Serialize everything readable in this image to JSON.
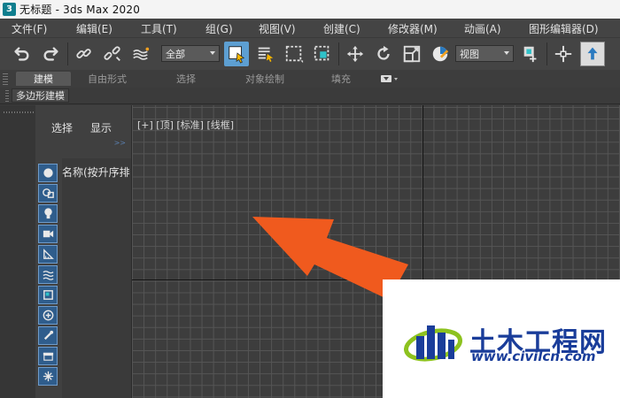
{
  "window": {
    "app_icon_letter": "3",
    "title": "无标题 - 3ds Max 2020"
  },
  "menu": {
    "items": [
      "文件(F)",
      "编辑(E)",
      "工具(T)",
      "组(G)",
      "视图(V)",
      "创建(C)",
      "修改器(M)",
      "动画(A)",
      "图形编辑器(D)"
    ]
  },
  "toolbar": {
    "selection_filter": "全部",
    "reference_coord": "视图",
    "icons": [
      "undo-icon",
      "redo-icon",
      "link-icon",
      "unlink-icon",
      "bind-space-warp-icon",
      "select-object-icon",
      "select-by-name-icon",
      "rect-selection-region-icon",
      "window-crossing-icon",
      "move-icon",
      "rotate-icon",
      "scale-icon",
      "selection-pivot-icon",
      "snap-icon",
      "select-and-place-icon"
    ],
    "active_color": "#5d9fd2"
  },
  "ribbon": {
    "tabs": [
      "建模",
      "自由形式",
      "选择",
      "对象绘制",
      "填充"
    ],
    "active_tab": "建模",
    "sub_label": "多边形建模"
  },
  "scene_explorer": {
    "tab_select": "选择",
    "tab_display": "显示",
    "pin_glyph": ">>",
    "column_header": "名称(按升序排",
    "filter_icons": [
      "geometry-filter-icon",
      "shape-filter-icon",
      "light-filter-icon",
      "camera-filter-icon",
      "helper-filter-icon",
      "spacewarp-filter-icon",
      "group-filter-icon",
      "xref-filter-icon",
      "bone-filter-icon",
      "container-filter-icon",
      "particle-filter-icon"
    ]
  },
  "viewport": {
    "label": "[+] [顶] [标准] [线框]",
    "annotation_arrow_color": "#f05a1e"
  },
  "watermark": {
    "name": "土木工程网",
    "url": "www.civilcn.com",
    "color": "#1a3d9a"
  }
}
